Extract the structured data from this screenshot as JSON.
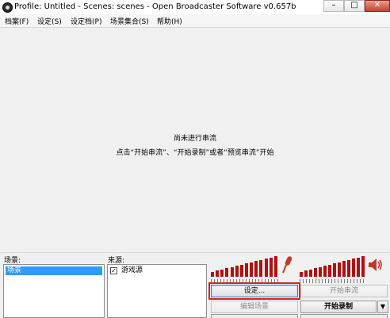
{
  "window": {
    "title": "Profile: Untitled - Scenes: scenes - Open Broadcaster Software v0.657b",
    "minimize_glyph": "–",
    "maximize_glyph": "□",
    "close_glyph": "✕"
  },
  "menu": {
    "items": [
      "档案(F)",
      "设定(S)",
      "设定档(P)",
      "场景集合(S)",
      "帮助(H)"
    ]
  },
  "preview": {
    "status": "尚未进行串流",
    "hint": "点击“开始串流”、“开始录制”或者“预览串流”开始"
  },
  "scenes": {
    "label": "场景:",
    "items": [
      {
        "name": "场景",
        "selected": true
      }
    ]
  },
  "sources": {
    "label": "来源:",
    "items": [
      {
        "name": "游戏源",
        "checked": true,
        "check_glyph": "✓"
      }
    ]
  },
  "audio": {
    "mic_icon": "microphone-icon",
    "speaker_icon": "speaker-icon",
    "colors": {
      "meter": "#b01010",
      "mic": "#c0392b"
    }
  },
  "buttons": {
    "settings": "设定...",
    "start_stream": "开始串流",
    "edit_scene": "编辑场景",
    "start_record": "开始录制",
    "dropdown_glyph": "▼"
  }
}
